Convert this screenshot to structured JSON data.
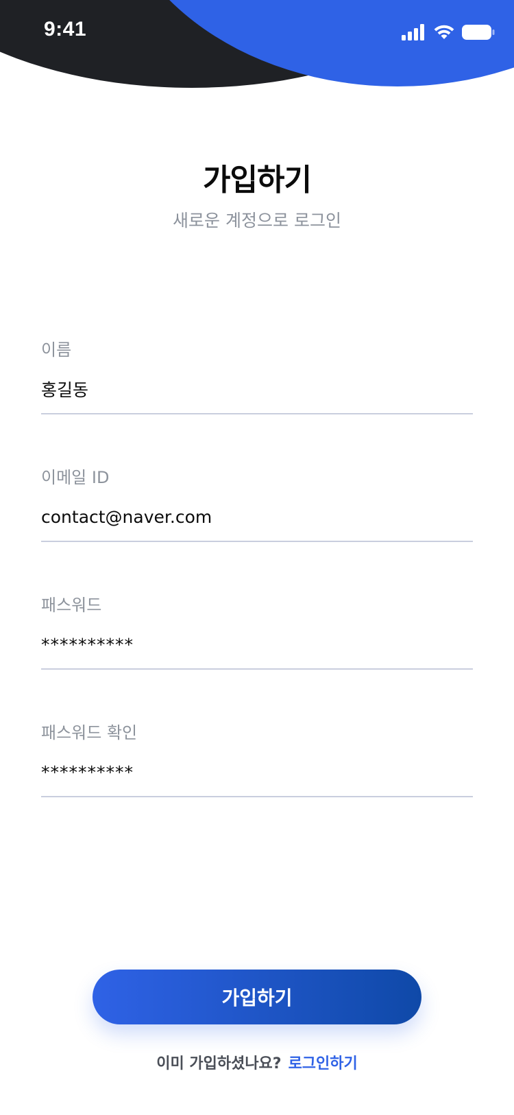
{
  "status_bar": {
    "time": "9:41"
  },
  "header": {
    "title": "가입하기",
    "subtitle": "새로운 계정으로 로그인"
  },
  "form": {
    "name": {
      "label": "이름",
      "value": "홍길동"
    },
    "email": {
      "label": "이메일 ID",
      "value": "contact@naver.com"
    },
    "password": {
      "label": "패스워드",
      "value": "**********"
    },
    "password_confirm": {
      "label": "패스워드 확인",
      "value": "**********"
    }
  },
  "actions": {
    "signup_label": "가입하기"
  },
  "footer": {
    "question": "이미 가입하셨나요?",
    "login_link": "로그인하기"
  },
  "colors": {
    "accent": "#2f62e6",
    "dark": "#1f2125",
    "label": "#8d939c",
    "divider": "#c9cede"
  },
  "icons": [
    "cellular-signal-icon",
    "wifi-icon",
    "battery-icon"
  ]
}
